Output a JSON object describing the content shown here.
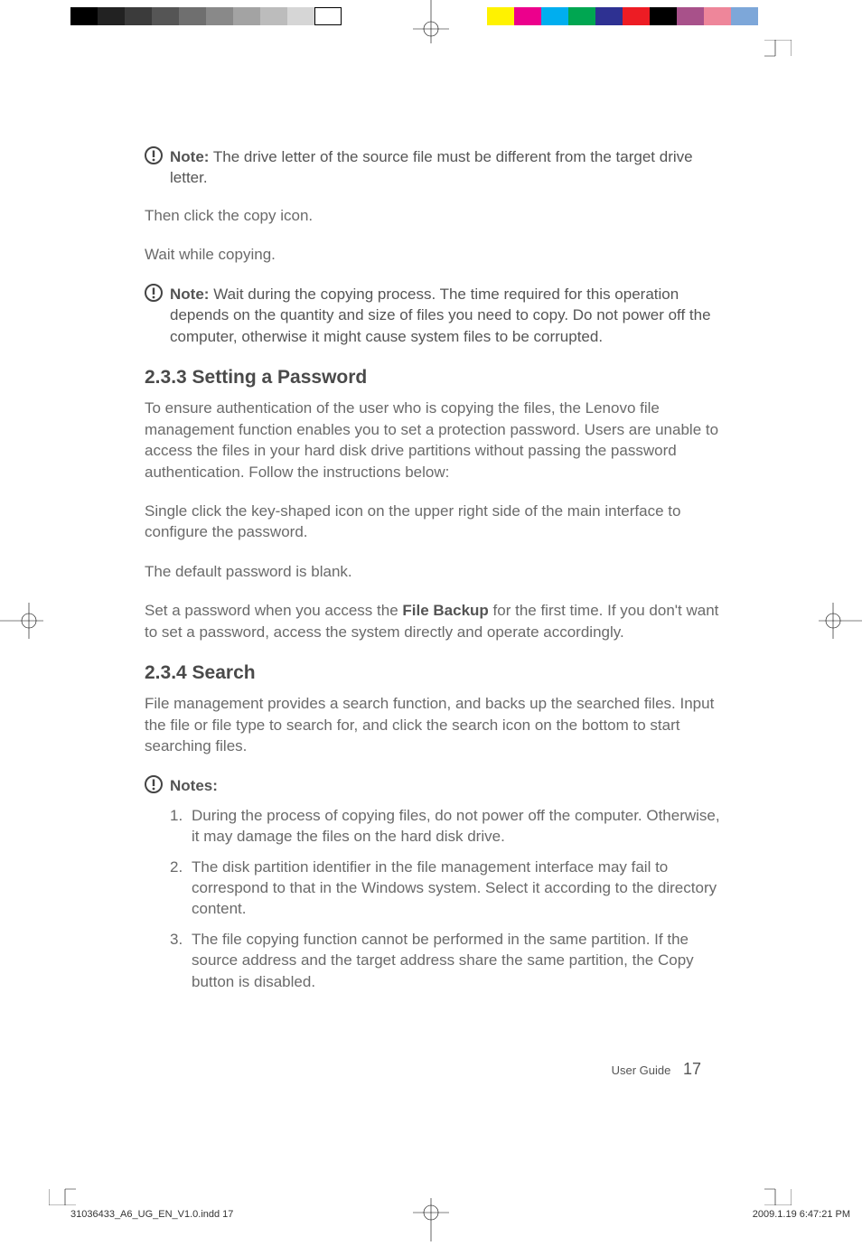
{
  "notes": {
    "label": "Note:",
    "text1": "The drive letter of the source file must be different from the target drive letter.",
    "text2": "Wait during the copying process. The time required for this operation depends on the quantity and size of files you need to copy. Do not power off the computer, otherwise it might cause system files to be corrupted."
  },
  "body": {
    "p1": "Then click the copy icon.",
    "p2": "Wait while copying.",
    "p3": "To ensure authentication of the user who is copying the files, the Lenovo file management function enables you to set a protection password. Users are unable to access the files in your hard disk drive partitions without passing the password authentication. Follow the instructions below:",
    "p4": "Single click the key-shaped icon on the upper right side of the main interface to configure the password.",
    "p5": "The default password is blank.",
    "p6a": "Set a password when you access the ",
    "p6bold": "File Backup",
    "p6b": " for the first time. If you don't want to set a password, access the system directly and operate accordingly.",
    "p7": "File management provides a search function, and backs up the searched files. Input the file or file type to search for, and click the search icon on the bottom to start searching files."
  },
  "headings": {
    "h1": "2.3.3 Setting a Password",
    "h2": "2.3.4 Search"
  },
  "notes2": {
    "label": "Notes:",
    "items": [
      {
        "n": "1.",
        "t": "During the process of copying files, do not power off the computer. Otherwise, it may damage the files on the hard disk drive."
      },
      {
        "n": "2.",
        "t": "The disk partition identifier in the file management interface may fail to correspond to that in the Windows system. Select it according to the directory content."
      },
      {
        "n": "3.",
        "t": "The file copying function cannot be performed in the same partition. If the source address and the target address share the same partition, the Copy button is disabled."
      }
    ]
  },
  "footer": {
    "label": "User Guide",
    "page": "17"
  },
  "slug": {
    "left": "31036433_A6_UG_EN_V1.0.indd   17",
    "right": "2009.1.19   6:47:21 PM"
  }
}
